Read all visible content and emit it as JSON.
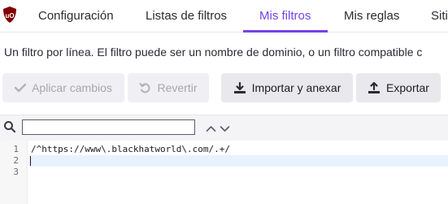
{
  "tabs": [
    {
      "label": "Configuración",
      "active": false
    },
    {
      "label": "Listas de filtros",
      "active": false
    },
    {
      "label": "Mis filtros",
      "active": true
    },
    {
      "label": "Mis reglas",
      "active": false
    },
    {
      "label": "Siti",
      "active": false
    }
  ],
  "logo": {
    "text": "uO",
    "color": "#800000"
  },
  "accent_color": "#7542e5",
  "description": "Un filtro por línea. El filtro puede ser un nombre de dominio, o un filtro compatible c",
  "toolbar": {
    "apply_label": "Aplicar cambios",
    "apply_icon": "check-icon",
    "revert_label": "Revertir",
    "revert_icon": "undo-icon",
    "import_label": "Importar y anexar",
    "import_icon": "import-icon",
    "export_label": "Exportar",
    "export_icon": "export-icon"
  },
  "search": {
    "value": "",
    "placeholder": ""
  },
  "editor": {
    "line_numbers": [
      "1",
      "2",
      "3"
    ],
    "lines": [
      "/^https://www\\.blackhatworld\\.com/.+/",
      "",
      ""
    ]
  }
}
